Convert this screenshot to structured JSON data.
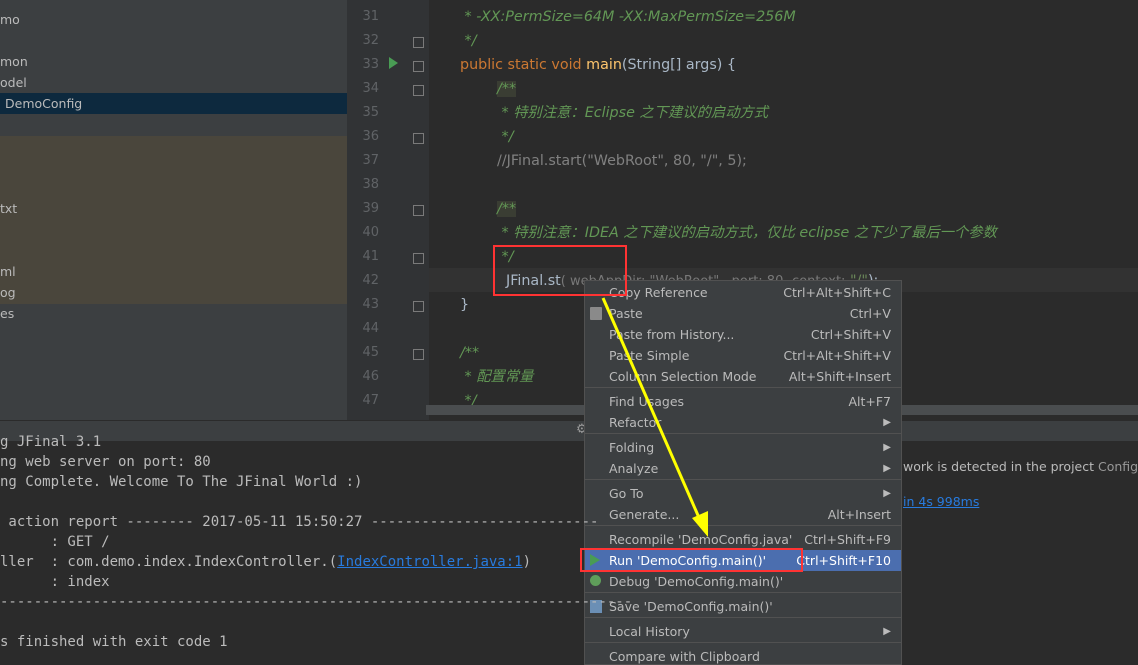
{
  "tree": {
    "items": [
      "mo",
      "mon",
      "odel",
      "DemoConfig",
      "txt",
      "ml",
      "og",
      "es"
    ]
  },
  "editor": {
    "lines": [
      {
        "n": "31"
      },
      {
        "n": "32"
      },
      {
        "n": "33"
      },
      {
        "n": "34"
      },
      {
        "n": "35"
      },
      {
        "n": "36"
      },
      {
        "n": "37"
      },
      {
        "n": "38"
      },
      {
        "n": "39"
      },
      {
        "n": "40"
      },
      {
        "n": "41"
      },
      {
        "n": "42"
      },
      {
        "n": "43"
      },
      {
        "n": "44"
      },
      {
        "n": "45"
      },
      {
        "n": "46"
      },
      {
        "n": "47"
      }
    ],
    "code": {
      "l31": " * -XX:PermSize=64M -XX:MaxPermSize=256M",
      "l32": " */",
      "l33_kw": "public static void",
      "l33_fn": "main",
      "l33_rest": "(String[] args) {",
      "l34": "/**",
      "l35": " * 特别注意：Eclipse 之下建议的启动方式",
      "l36": " */",
      "l37": "//JFinal.start(\"WebRoot\", 80, \"/\", 5);",
      "l39": "/**",
      "l40": " * 特别注意：IDEA 之下建议的启动方式，仅比 eclipse 之下少了最后一个参数",
      "l41": " */",
      "l42_a": "JFinal.st",
      "l42_b": "( webAppDir: \"WebRoot\",  port: 80,",
      "l42_hint": "context:",
      "l42_str": "\"/\"",
      "l42_end": ");",
      "l43": "}",
      "l45": "/**",
      "l46": " * 配置常量",
      "l47": " */"
    }
  },
  "console": {
    "lines": [
      "g JFinal 3.1",
      "ng web server on port: 80",
      "ng Complete. Welcome To The JFinal World :)",
      "",
      " action report -------- 2017-05-11 15:50:27 ---------------------------",
      "      : GET /",
      "ller  : com.demo.index.IndexController.(",
      "      : index",
      "---------------------------------------------------------------------------",
      "",
      "s finished with exit code 1"
    ],
    "link": "IndexController.java:1",
    "link_close": ")",
    "notice_text": "work is detected in the project",
    "notice_link": "Configure",
    "notice_time": "in 4s 998ms"
  },
  "menu": {
    "items": [
      {
        "label": "Copy Reference",
        "shortcut": "Ctrl+Alt+Shift+C"
      },
      {
        "label": "Paste",
        "shortcut": "Ctrl+V"
      },
      {
        "label": "Paste from History...",
        "shortcut": "Ctrl+Shift+V"
      },
      {
        "label": "Paste Simple",
        "shortcut": "Ctrl+Alt+Shift+V"
      },
      {
        "label": "Column Selection Mode",
        "shortcut": "Alt+Shift+Insert"
      },
      {
        "label": "Find Usages",
        "shortcut": "Alt+F7"
      },
      {
        "label": "Refactor",
        "shortcut": ""
      },
      {
        "label": "Folding",
        "shortcut": ""
      },
      {
        "label": "Analyze",
        "shortcut": ""
      },
      {
        "label": "Go To",
        "shortcut": ""
      },
      {
        "label": "Generate...",
        "shortcut": "Alt+Insert"
      },
      {
        "label": "Recompile 'DemoConfig.java'",
        "shortcut": "Ctrl+Shift+F9"
      },
      {
        "label": "Run 'DemoConfig.main()'",
        "shortcut": "Ctrl+Shift+F10"
      },
      {
        "label": "Debug 'DemoConfig.main()'",
        "shortcut": ""
      },
      {
        "label": "Save 'DemoConfig.main()'",
        "shortcut": ""
      },
      {
        "label": "Local History",
        "shortcut": ""
      },
      {
        "label": "Compare with Clipboard",
        "shortcut": ""
      }
    ],
    "active_color": "#4b6eaf"
  },
  "colors": {
    "annotation_red": "#ff3333",
    "arrow_yellow": "#ffff00",
    "run_green": "#499c54"
  }
}
